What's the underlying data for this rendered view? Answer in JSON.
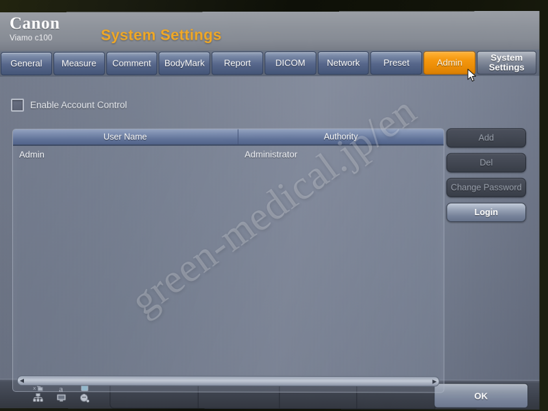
{
  "brand": {
    "logo": "Canon",
    "model": "Viamo c100"
  },
  "header": {
    "title": "System Settings"
  },
  "tabs": [
    {
      "label": "General",
      "active": false
    },
    {
      "label": "Measure",
      "active": false
    },
    {
      "label": "Comment",
      "active": false
    },
    {
      "label": "BodyMark",
      "active": false
    },
    {
      "label": "Report",
      "active": false
    },
    {
      "label": "DICOM",
      "active": false
    },
    {
      "label": "Network",
      "active": false
    },
    {
      "label": "Preset",
      "active": false
    },
    {
      "label": "Admin",
      "active": true
    }
  ],
  "system_settings_tab": {
    "line1": "System",
    "line2": "Settings"
  },
  "options": {
    "enable_account_control_label": "Enable Account Control",
    "enable_account_control_checked": false
  },
  "user_table": {
    "columns": [
      "User Name",
      "Authority"
    ],
    "rows": [
      {
        "user_name": "Admin",
        "authority": "Administrator"
      }
    ]
  },
  "side_buttons": [
    {
      "label": "Add",
      "enabled": false
    },
    {
      "label": "Del",
      "enabled": false
    },
    {
      "label": "Change Password",
      "enabled": false
    },
    {
      "label": "Login",
      "enabled": true
    }
  ],
  "scrollbar": {
    "left_arrow": "◀",
    "right_arrow": "▶"
  },
  "status_icons": [
    "network-disconnected-icon",
    "text-input-a-icon",
    "battery-icon",
    "network-icon",
    "monitor-icon",
    "power-plug-icon"
  ],
  "status_icon_letter": "a",
  "bottom_bar": {
    "segments": [
      "",
      "",
      "",
      ""
    ],
    "ok_label": "OK"
  },
  "colors": {
    "accent_orange": "#f0a826",
    "active_tab_orange": "#ea8c06",
    "tab_blue": "#56668a",
    "panel_blue": "#7e8698",
    "header_gray": "#8e939b",
    "bottom_dark": "#3c414c"
  },
  "watermark": {
    "text": "green-medical.jp/en"
  }
}
